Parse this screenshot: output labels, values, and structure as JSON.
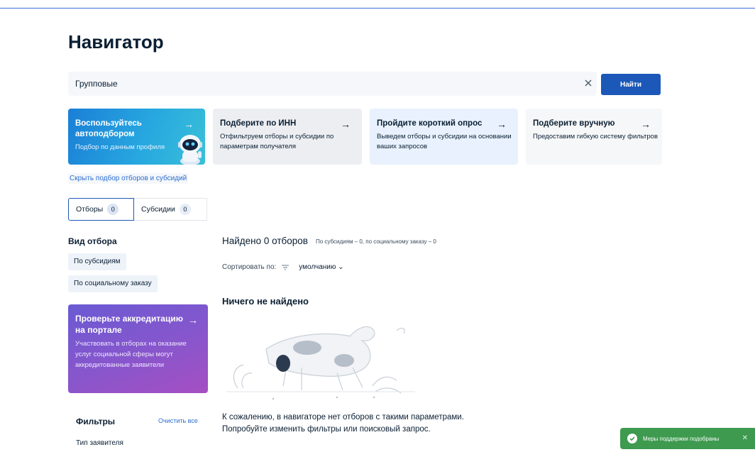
{
  "page": {
    "title": "Навигатор"
  },
  "search": {
    "value": "Групповые",
    "button_label": "Найти"
  },
  "cards": [
    {
      "title": "Воспользуйтесь автоподбором",
      "desc": "Подбор по данным профиля",
      "arrow": "→"
    },
    {
      "title": "Подберите по ИНН",
      "desc": "Отфильтруем отборы и субсидии по параметрам получателя",
      "arrow": "→"
    },
    {
      "title": "Пройдите короткий опрос",
      "desc": "Выведем отборы и субсидии на основании ваших запросов",
      "arrow": "→"
    },
    {
      "title": "Подберите вручную",
      "desc": "Предоставим гибкую систему фильтров",
      "arrow": "→"
    }
  ],
  "hide_link": "Скрыть подбор отборов и субсидий",
  "tabs": [
    {
      "label": "Отборы",
      "count": "0"
    },
    {
      "label": "Субсидии",
      "count": "0"
    }
  ],
  "sidebar": {
    "heading": "Вид отбора",
    "chips": [
      "По субсидиям",
      "По социальному заказу"
    ],
    "promo": {
      "title": "Проверьте аккредитацию на портале",
      "desc": "Участвовать в отборах на оказание услуг социальной сферы могут аккредитованные заявители",
      "arrow": "→"
    },
    "filters_heading": "Фильтры",
    "clear_all": "Очистить все",
    "filter_type": "Тип заявителя"
  },
  "results": {
    "found": "Найдено 0 отборов",
    "found_sub": "По субсидиям – 0, по социальному заказу – 0",
    "sort_label": "Сортировать по:",
    "sort_value": "умолчанию",
    "sort_chevron": "⌄",
    "empty_title": "Ничего не найдено",
    "empty_line1": "К сожалению, в навигаторе нет отборов с такими параметрами.",
    "empty_line2": "Попробуйте изменить фильтры или поисковый запрос."
  },
  "toast": {
    "text": "Меры поддержки подобраны",
    "close": "✕",
    "color": "#3d9a4f"
  },
  "colors": {
    "primary": "#1b58b8",
    "link": "#2b6ed1"
  }
}
